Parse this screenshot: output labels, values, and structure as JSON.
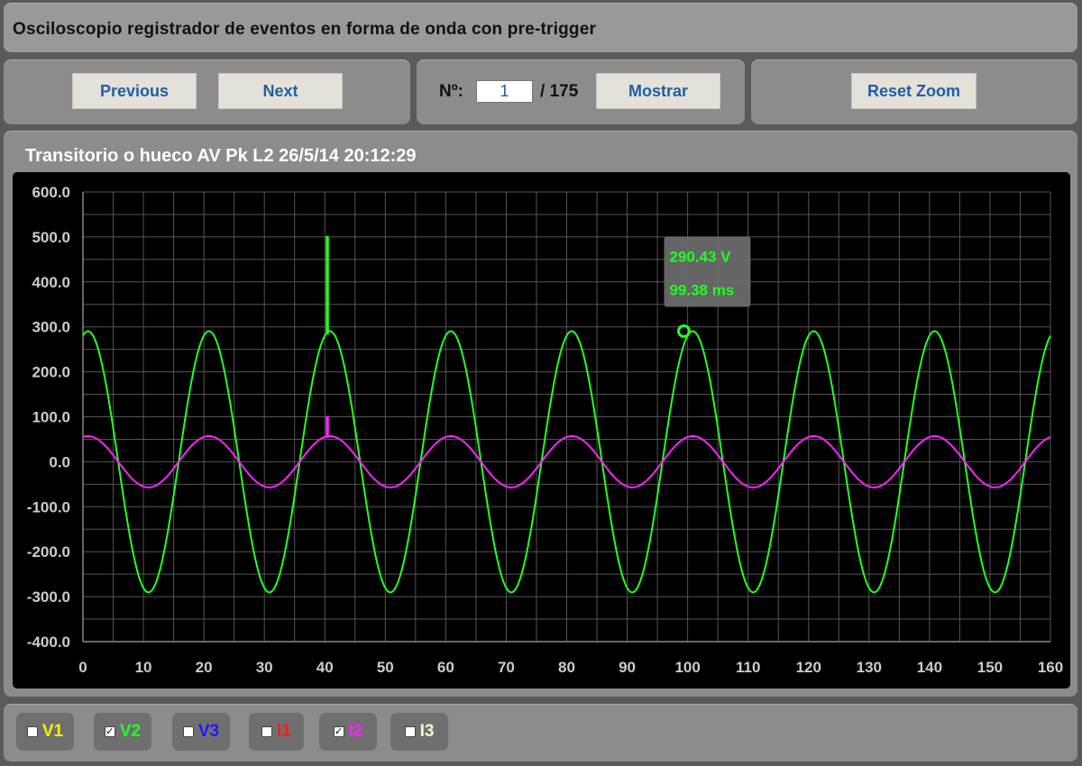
{
  "header": {
    "title": "Osciloscopio registrador de eventos en forma de onda con pre-trigger"
  },
  "nav": {
    "previous_label": "Previous",
    "next_label": "Next"
  },
  "event_selector": {
    "label": "Nº:",
    "current": "1",
    "total_text": "/ 175",
    "show_label": "Mostrar"
  },
  "zoom": {
    "reset_label": "Reset Zoom"
  },
  "chart_title": "Transitorio o hueco AV Pk L2 26/5/14 20:12:29",
  "tooltip": {
    "value": "290.43 V",
    "time": "99.38 ms"
  },
  "legend": [
    {
      "label": "V1",
      "checked": false,
      "color": "#f4f000"
    },
    {
      "label": "V2",
      "checked": true,
      "color": "#22ff22"
    },
    {
      "label": "V3",
      "checked": false,
      "color": "#1a1aff"
    },
    {
      "label": "I1",
      "checked": false,
      "color": "#ff1a1a"
    },
    {
      "label": "I2",
      "checked": true,
      "color": "#ff22ff"
    },
    {
      "label": "I3",
      "checked": false,
      "color": "#fff5c8"
    }
  ],
  "chart_data": {
    "type": "line",
    "xlim": [
      0,
      160
    ],
    "ylim": [
      -400,
      600
    ],
    "x_ticks": [
      "0",
      "10",
      "20",
      "30",
      "40",
      "50",
      "60",
      "70",
      "80",
      "90",
      "100",
      "110",
      "120",
      "130",
      "140",
      "150",
      "160"
    ],
    "y_ticks": [
      "600.0",
      "500.0",
      "400.0",
      "300.0",
      "200.0",
      "100.0",
      "0.0",
      "-100.0",
      "-200.0",
      "-300.0",
      "-400.0"
    ],
    "grid": true,
    "background": "#000000",
    "series": [
      {
        "color": "#22ff22",
        "waveform": "sine",
        "amplitude": 290.43,
        "frequency_hz": 50,
        "phase_deg": 75,
        "transient": {
          "x": 40.3,
          "peak": 500,
          "base": 285
        }
      },
      {
        "color": "#ff22ff",
        "waveform": "sine",
        "amplitude": 57,
        "frequency_hz": 50,
        "phase_deg": 75,
        "transient": {
          "x": 40.3,
          "peak": 100,
          "base": 55
        }
      }
    ],
    "marker": {
      "x": 99.38,
      "y": 290.43,
      "color": "#22ff22"
    }
  }
}
